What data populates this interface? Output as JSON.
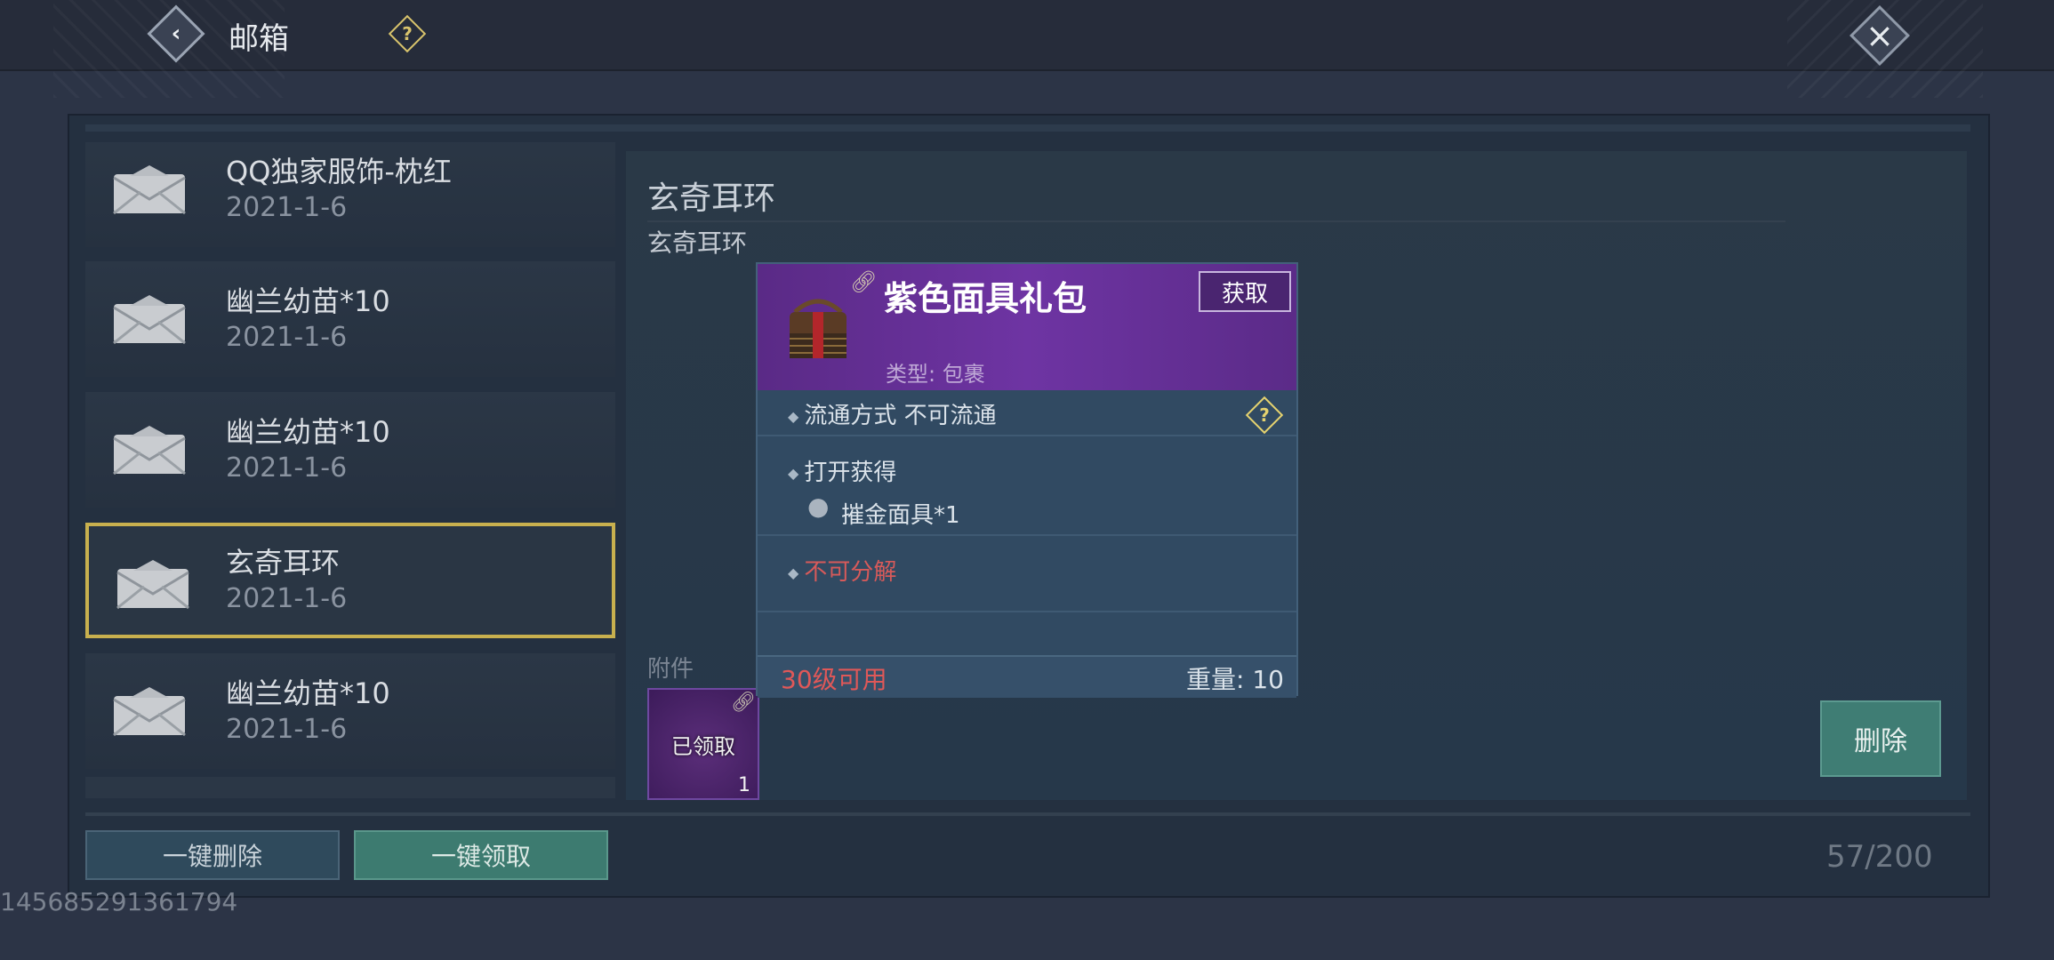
{
  "header": {
    "title": "邮箱"
  },
  "mail_list": [
    {
      "title": "QQ独家服饰-枕红",
      "date": "2021-1-6",
      "selected": false
    },
    {
      "title": "幽兰幼苗*10",
      "date": "2021-1-6",
      "selected": false
    },
    {
      "title": "幽兰幼苗*10",
      "date": "2021-1-6",
      "selected": false
    },
    {
      "title": "玄奇耳环",
      "date": "2021-1-6",
      "selected": true
    },
    {
      "title": "幽兰幼苗*10",
      "date": "2021-1-6",
      "selected": false
    }
  ],
  "detail": {
    "title": "玄奇耳环",
    "body": "玄奇耳环",
    "attachments_label": "附件",
    "attachment": {
      "status": "已领取",
      "count": "1"
    },
    "delete_label": "删除"
  },
  "footer": {
    "delete_all_label": "一键删除",
    "claim_all_label": "一键领取",
    "mail_count": "57/200",
    "uid": "145685291361794"
  },
  "tooltip": {
    "name": "紫色面具礼包",
    "get_label": "获取",
    "type": "类型: 包裹",
    "circulation": "流通方式   不可流通",
    "open_label": "打开获得",
    "open_item": "摧金面具*1",
    "decompose": "不可分解",
    "level": "30级可用",
    "weight": "重量: 10"
  },
  "colors": {
    "selected_border": "#c8b04e",
    "tooltip_header": "#6e34a3",
    "warning_red": "#e05858",
    "accent_green": "#3f7d74"
  }
}
